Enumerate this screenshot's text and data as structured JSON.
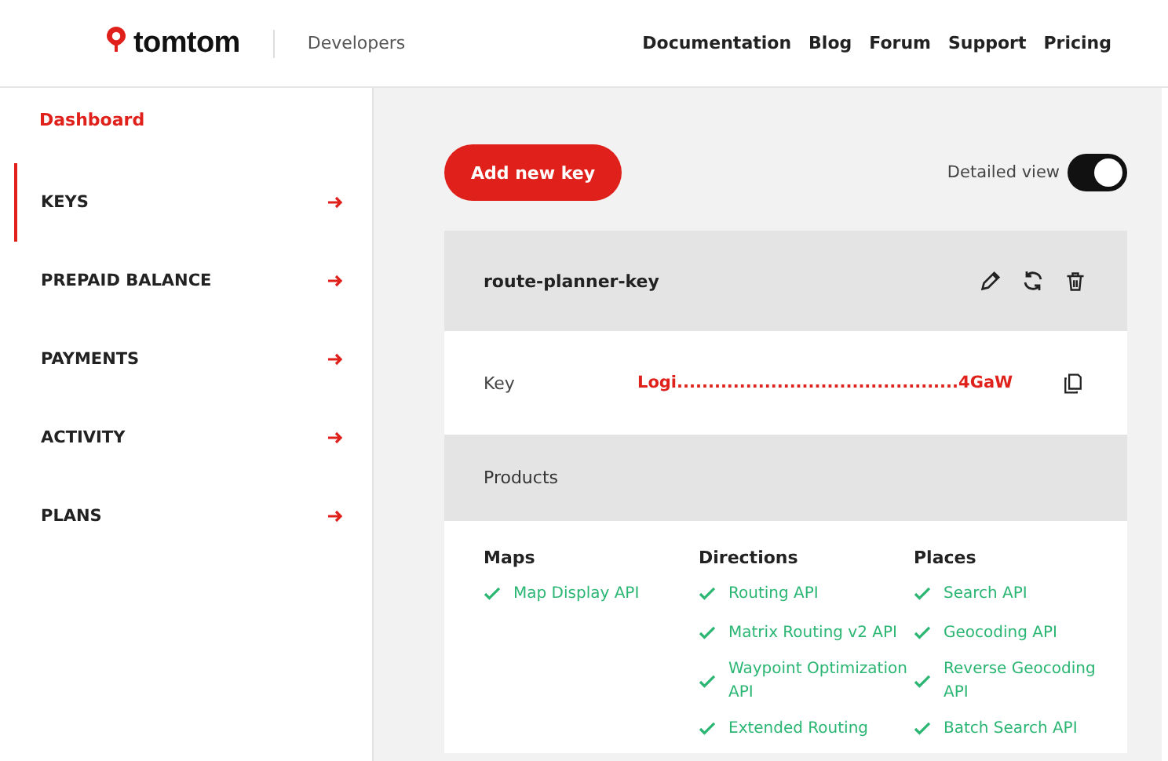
{
  "header": {
    "brand": "tomtom",
    "section": "Developers",
    "nav": [
      "Documentation",
      "Blog",
      "Forum",
      "Support",
      "Pricing"
    ]
  },
  "sidebar": {
    "title": "Dashboard",
    "items": [
      {
        "label": "KEYS",
        "selected": true
      },
      {
        "label": "PREPAID BALANCE",
        "selected": false
      },
      {
        "label": "PAYMENTS",
        "selected": false
      },
      {
        "label": "ACTIVITY",
        "selected": false
      },
      {
        "label": "PLANS",
        "selected": false
      }
    ]
  },
  "add_button": "Add new key",
  "detailed_view": {
    "label": "Detailed view",
    "on": true
  },
  "key_card": {
    "name": "route-planner-key",
    "key_label": "Key",
    "key_value": "Logi.............................................4GaW",
    "products_label": "Products",
    "groups": [
      {
        "title": "Maps",
        "items": [
          "Map Display API"
        ]
      },
      {
        "title": "Directions",
        "items": [
          "Routing API",
          "Matrix Routing v2 API",
          "Waypoint Optimization API",
          "Extended Routing"
        ]
      },
      {
        "title": "Places",
        "items": [
          "Search API",
          "Geocoding API",
          "Reverse Geocoding API",
          "Batch Search API"
        ]
      }
    ]
  }
}
